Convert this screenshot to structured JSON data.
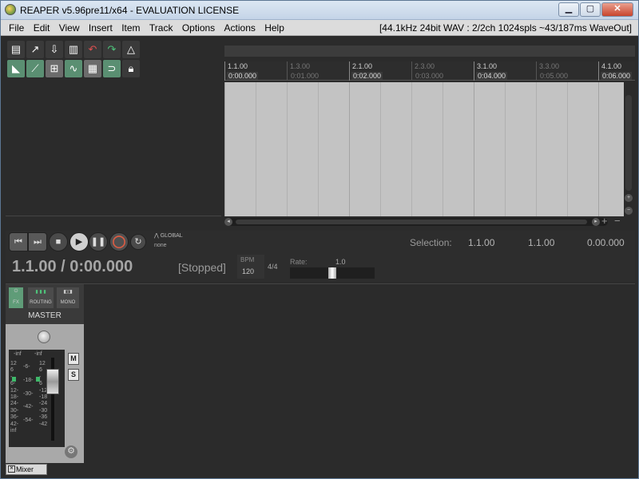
{
  "window": {
    "title": "REAPER v5.96pre11/x64 - EVALUATION LICENSE",
    "minimize_glyph": "▁",
    "maximize_glyph": "▢",
    "close_glyph": "✕"
  },
  "menu": {
    "items": [
      "File",
      "Edit",
      "View",
      "Insert",
      "Item",
      "Track",
      "Options",
      "Actions",
      "Help"
    ],
    "status": "[44.1kHz 24bit WAV : 2/2ch 1024spls ~43/187ms WaveOut]"
  },
  "toolbar": {
    "icons": [
      "new-project-icon",
      "open-project-icon",
      "save-project-icon",
      "project-settings-icon",
      "undo-icon",
      "redo-icon",
      "metronome-icon",
      "auto-crossfade-icon",
      "ripple-edit-icon",
      "grid-snap-icon",
      "envelope-lock-icon",
      "grid-icon",
      "loop-icon",
      "lock-icon"
    ]
  },
  "ruler": {
    "marks": [
      {
        "label": "1.1.00",
        "time": "0:00.000",
        "major": true
      },
      {
        "label": "1.3.00",
        "time": "0:01.000",
        "major": false
      },
      {
        "label": "2.1.00",
        "time": "0:02.000",
        "major": true
      },
      {
        "label": "2.3.00",
        "time": "0:03.000",
        "major": false
      },
      {
        "label": "3.1.00",
        "time": "0:04.000",
        "major": true
      },
      {
        "label": "3.3.00",
        "time": "0:05.000",
        "major": false
      },
      {
        "label": "4.1.00",
        "time": "0:06.000",
        "major": true
      }
    ]
  },
  "transport": {
    "global_label": "GLOBAL",
    "global_value": "none",
    "position": "1.1.00 / 0:00.000",
    "state": "[Stopped]",
    "bpm_label": "BPM",
    "bpm": "120",
    "time_signature": "4/4",
    "rate_label": "Rate:",
    "rate": "1.0",
    "rate_slider_position": 0.5,
    "selection_label": "Selection:",
    "selection_start": "1.1.00",
    "selection_end": "1.1.00",
    "selection_length": "0.00.000"
  },
  "mixer": {
    "fx_label": "FX",
    "routing_label": "ROUTING",
    "mono_label": "MONO",
    "master_label": "MASTER",
    "mute_label": "M",
    "solo_label": "S",
    "meter_peak_left": "-inf",
    "meter_peak_right": "-inf",
    "scale_left": [
      "12",
      "6",
      "-",
      "6-",
      "12-",
      "18-",
      "24-",
      "30-",
      "36-",
      "42-",
      "inf"
    ],
    "scale_mid": [
      "-6-",
      "",
      "-18-",
      "",
      "-30-",
      "",
      "-42-",
      "",
      "-54-"
    ],
    "scale_right": [
      "12",
      "6",
      "-",
      "6",
      "-12",
      "-18",
      "-24",
      "-30",
      "-36",
      "-42"
    ],
    "tab_label": "Mixer"
  },
  "colors": {
    "background": "#2b2b2b",
    "arrange": "#c3c3c3",
    "meter_green": "#3fb86a",
    "record": "#e25d43"
  }
}
